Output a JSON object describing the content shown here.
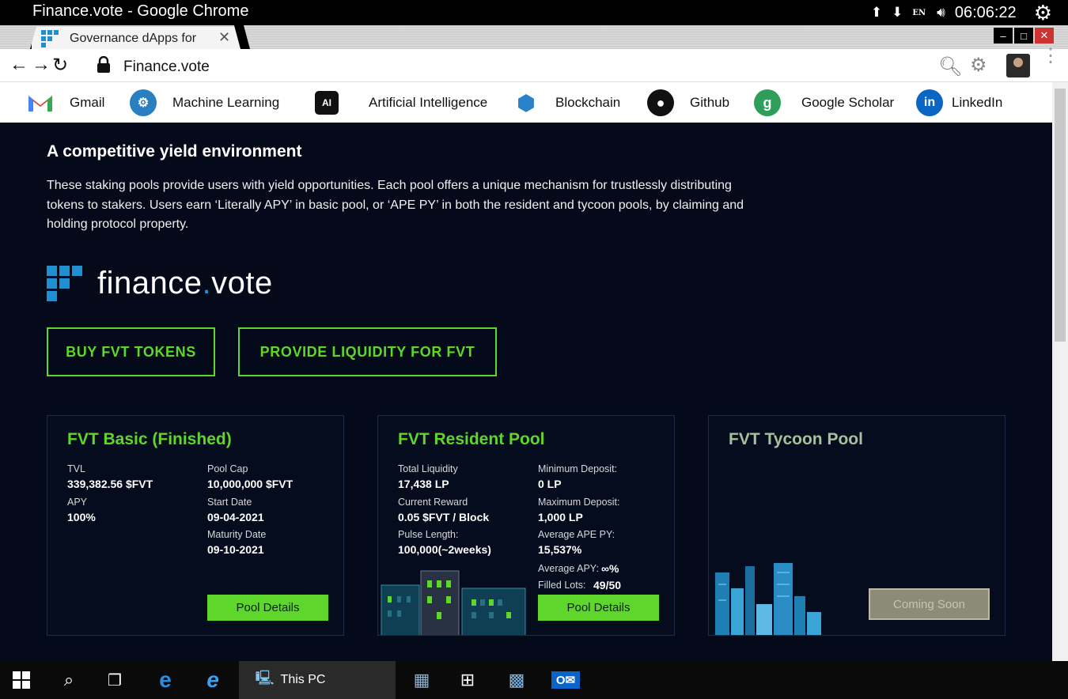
{
  "os": {
    "window_title": "Finance.vote - Google Chrome",
    "lang": "EN",
    "clock": "06:06:22"
  },
  "browser": {
    "tab_title": "Governance dApps for",
    "url": "Finance.vote",
    "bookmarks": [
      {
        "label": "Gmail",
        "icon": "gmail-icon",
        "color": "#d44638"
      },
      {
        "label": "Machine Learning",
        "icon": "machine-learning-icon",
        "color": "#2a7fc0"
      },
      {
        "label": "Artificial Intelligence",
        "icon": "ai-chip-icon",
        "color": "#111111"
      },
      {
        "label": "Blockchain",
        "icon": "blockchain-icon",
        "color": "#2b82c9"
      },
      {
        "label": "Github",
        "icon": "github-icon",
        "color": "#111111"
      },
      {
        "label": "Google Scholar",
        "icon": "google-scholar-icon",
        "color": "#2d9f5a"
      },
      {
        "label": "LinkedIn",
        "icon": "linkedin-icon",
        "color": "#0a66c2"
      }
    ]
  },
  "page": {
    "heading": "A competitive yield environment",
    "description": "These staking pools provide users with yield opportunities. Each pool offers a unique mechanism for trustlessly distributing tokens to stakers. Users earn ‘Literally APY’ in basic pool, or ‘APE PY’ in both the resident and tycoon pools, by claiming and holding protocol property.",
    "logo_text_a": "finance",
    "logo_text_dot": ".",
    "logo_text_b": "vote",
    "buy_button": "BUY FVT TOKENS",
    "liquidity_button": "PROVIDE LIQUIDITY FOR FVT",
    "accent_color": "#5ed62b"
  },
  "cards": {
    "basic": {
      "title": "FVT Basic (Finished)",
      "tvl_label": "TVL",
      "tvl_value": "339,382.56 $FVT",
      "apy_label": "APY",
      "apy_value": "100%",
      "cap_label": "Pool Cap",
      "cap_value": "10,000,000 $FVT",
      "start_label": "Start Date",
      "start_value": "09-04-2021",
      "maturity_label": "Maturity Date",
      "maturity_value": "09-10-2021",
      "button": "Pool Details"
    },
    "resident": {
      "title": "FVT Resident Pool",
      "liq_label": "Total Liquidity",
      "liq_value": "17,438 LP",
      "reward_label": "Current Reward",
      "reward_value": "0.05 $FVT / Block",
      "pulse_label": "Pulse Length:",
      "pulse_value": "100,000(~2weeks)",
      "min_label": "Minimum Deposit:",
      "min_value": "0 LP",
      "max_label": "Maximum Deposit:",
      "max_value": "1,000 LP",
      "ape_label": "Average APE PY:",
      "ape_value": "15,537%",
      "avg_apy_label": "Average APY:",
      "avg_apy_value": "∞%",
      "lots_label": "Filled Lots:",
      "lots_value": "49/50",
      "button": "Pool Details"
    },
    "tycoon": {
      "title": "FVT Tycoon Pool",
      "button": "Coming Soon"
    }
  },
  "taskbar": {
    "active_label": "This PC"
  }
}
